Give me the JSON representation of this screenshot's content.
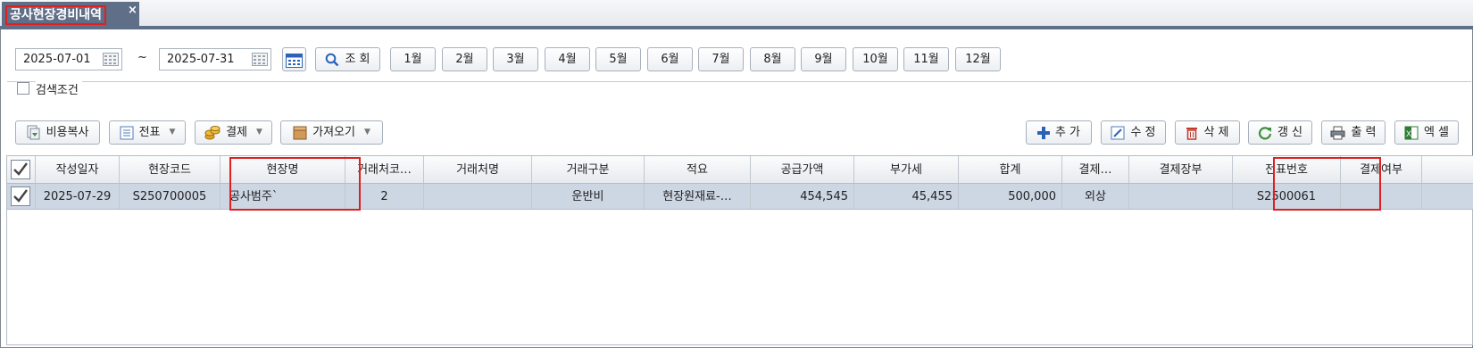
{
  "tab": {
    "title": "공사현장경비내역",
    "close_icon": "×"
  },
  "filters": {
    "date_from": "2025-07-01",
    "separator": "~",
    "date_to": "2025-07-31",
    "search_label": "조 회",
    "months": [
      "1월",
      "2월",
      "3월",
      "4월",
      "5월",
      "6월",
      "7월",
      "8월",
      "9월",
      "10월",
      "11월",
      "12월"
    ],
    "search_conditions_label": "검색조건"
  },
  "toolbar_left": {
    "copy_cost": "비용복사",
    "voucher": "전표",
    "payment": "결제",
    "import": "가져오기"
  },
  "toolbar_right": {
    "add": "추 가",
    "edit": "수 정",
    "delete": "삭 제",
    "refresh": "갱 신",
    "print": "출 력",
    "excel": "엑 셀"
  },
  "grid": {
    "columns": [
      "작성일자",
      "현장코드",
      "현장명",
      "거래처코…",
      "거래처명",
      "거래구분",
      "적요",
      "공급가액",
      "부가세",
      "합계",
      "결제…",
      "결제장부",
      "전표번호",
      "결제여부"
    ],
    "rows": [
      {
        "date": "2025-07-29",
        "site_code": "S250700005",
        "site_name": "공사범주`",
        "client_code": "2",
        "client_name": "",
        "trade_type": "운반비",
        "summary": "현장원재료-…",
        "supply": "454,545",
        "vat": "45,455",
        "total": "500,000",
        "payment": "외상",
        "ledger": "",
        "voucher_no": "S2500061",
        "paid": ""
      }
    ]
  },
  "colors": {
    "tab_bg": "#5f6f88",
    "row_selected": "#cdd6e3",
    "highlight": "#e02020"
  }
}
